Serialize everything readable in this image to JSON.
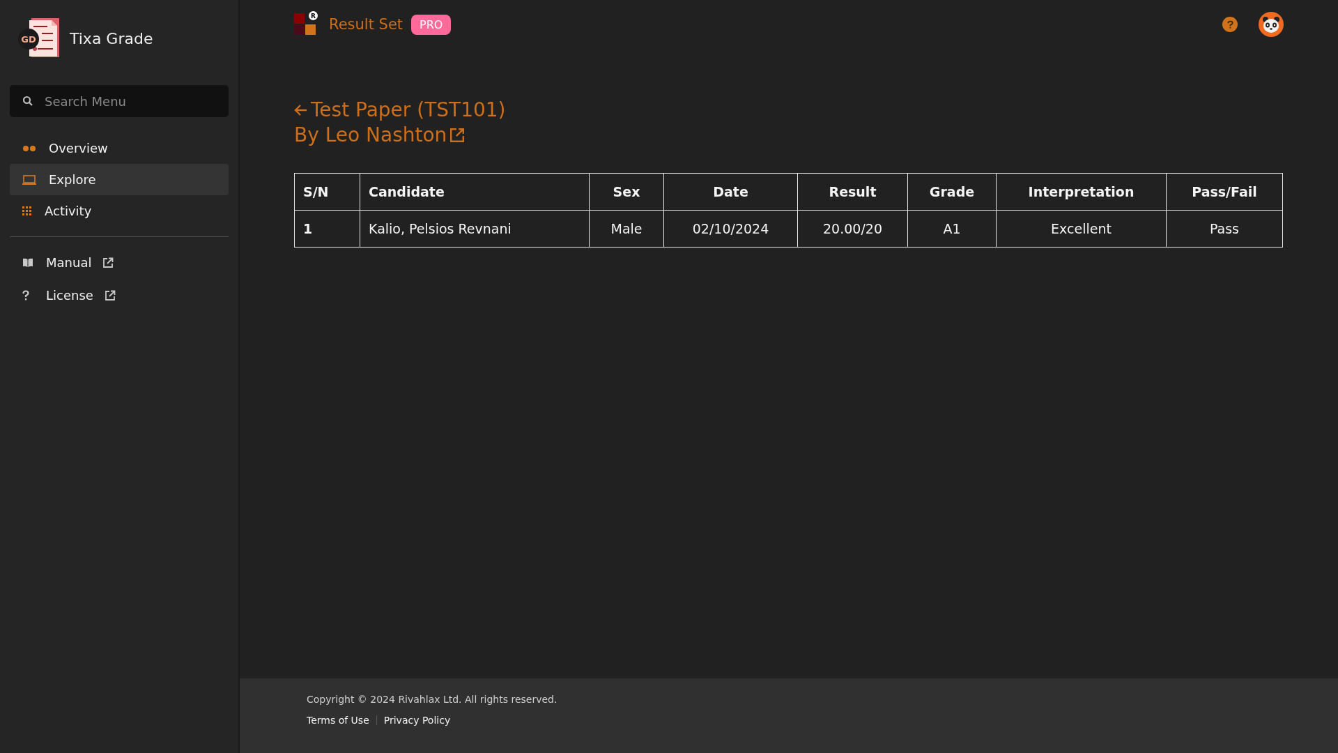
{
  "sidebar": {
    "brand": {
      "logo_mark": "GD",
      "name": "Tixa Grade"
    },
    "search": {
      "placeholder": "Search Menu"
    },
    "items": [
      {
        "kind": "overview",
        "label": "Overview",
        "selected": false
      },
      {
        "kind": "explore",
        "label": "Explore",
        "selected": true
      },
      {
        "kind": "activity",
        "label": "Activity",
        "selected": false
      }
    ],
    "links": [
      {
        "kind": "manual",
        "label": "Manual",
        "selected": false,
        "external": true
      },
      {
        "kind": "license",
        "label": "License",
        "selected": false,
        "external": true
      }
    ]
  },
  "header": {
    "logo_mark": "R",
    "title": "Result Set",
    "badge": "PRO"
  },
  "page": {
    "title": "Test Paper (TST101)",
    "author": "By Leo Nashton"
  },
  "table": {
    "columns": [
      "S/N",
      "Candidate",
      "Sex",
      "Date",
      "Result",
      "Grade",
      "Interpretation",
      "Pass/Fail"
    ],
    "rows": [
      [
        "1",
        "Kalio, Pelsios Revnani",
        "Male",
        "02/10/2024",
        "20.00/20",
        "A1",
        "Excellent",
        "Pass"
      ]
    ]
  },
  "footer": {
    "copyright": "Copyright © 2024 Rivahlax Ltd. All rights reserved.",
    "links": [
      "Terms of Use",
      "Privacy Policy"
    ]
  }
}
